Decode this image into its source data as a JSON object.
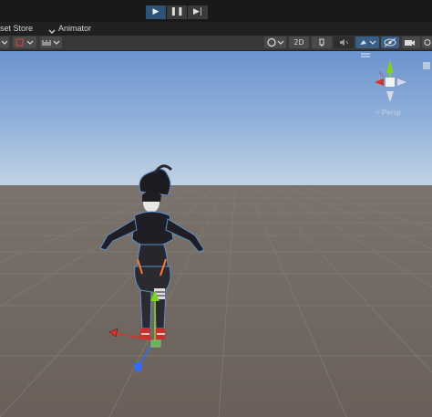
{
  "top": {
    "play_icon": "play-icon",
    "pause_icon": "pause-icon",
    "step_icon": "step-icon",
    "play_glyph": "▶",
    "pause_glyph": "❚❚",
    "step_glyph": "▶|"
  },
  "tabs": {
    "asset_store": "set Store",
    "animator": "Animator"
  },
  "toolbar": {
    "view_2d": "2D",
    "icons": [
      "layers-icon",
      "grid-icon",
      "ruler-icon",
      "shading-icon",
      "audio-icon",
      "fx-icon",
      "camera-icon",
      "gizmos-icon",
      "visibility-icon"
    ]
  },
  "scene": {
    "projection_label": "< Persp",
    "sky_top": "#6d95cf",
    "sky_bottom": "#b9cfe4",
    "ground_color": "#6e655e",
    "axis_colors": {
      "x": "#d8322b",
      "y": "#7ed321",
      "z": "#2f6bff"
    }
  }
}
